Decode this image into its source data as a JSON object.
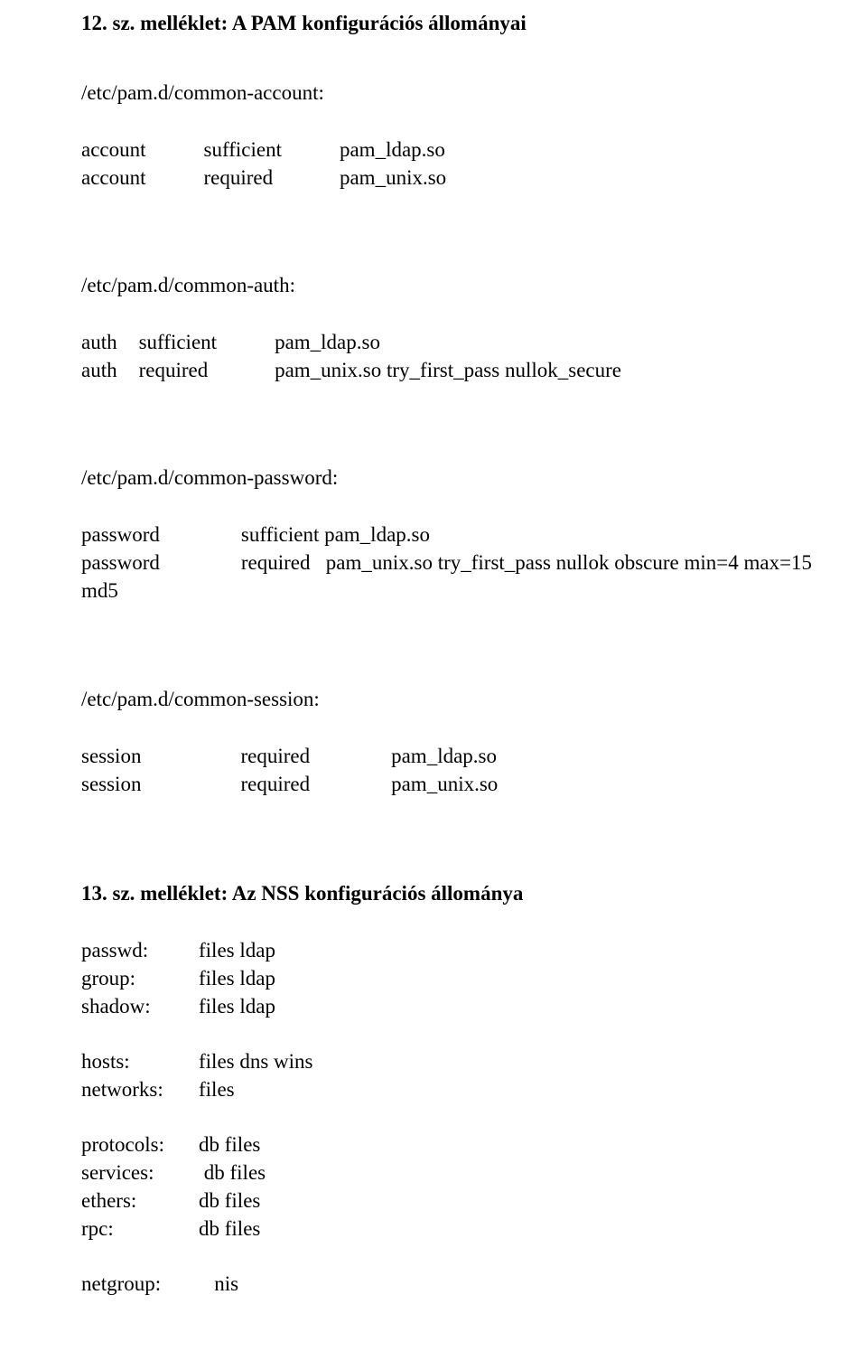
{
  "section12": {
    "title": "12. sz. melléklet: A PAM konfigurációs állományai",
    "account": {
      "path": "/etc/pam.d/common-account:",
      "rows": [
        {
          "facility": "account",
          "control": "sufficient",
          "module": "pam_ldap.so"
        },
        {
          "facility": "account",
          "control": "required",
          "module": "pam_unix.so"
        }
      ]
    },
    "auth": {
      "path": "/etc/pam.d/common-auth:",
      "rows": [
        {
          "facility": "auth",
          "control": "sufficient",
          "module": "pam_ldap.so"
        },
        {
          "facility": "auth",
          "control": "required",
          "module": "pam_unix.so try_first_pass nullok_secure"
        }
      ]
    },
    "password": {
      "path": "/etc/pam.d/common-password:",
      "rows": [
        {
          "facility": "password",
          "rest": "sufficient pam_ldap.so"
        },
        {
          "facility": "password",
          "rest": "required   pam_unix.so try_first_pass nullok obscure min=4 max=15"
        },
        {
          "facility": "md5",
          "rest": ""
        }
      ]
    },
    "session": {
      "path": "/etc/pam.d/common-session:",
      "rows": [
        {
          "facility": "session",
          "control": "required",
          "module": "pam_ldap.so"
        },
        {
          "facility": "session",
          "control": "required",
          "module": "pam_unix.so"
        }
      ]
    }
  },
  "section13": {
    "title": "13. sz. melléklet: Az NSS konfigurációs állománya",
    "group1": [
      {
        "key": "passwd:",
        "value": "files ldap"
      },
      {
        "key": "group:",
        "value": "files ldap"
      },
      {
        "key": "shadow:",
        "value": "files ldap"
      }
    ],
    "group2": [
      {
        "key": "hosts:",
        "value": "files dns wins"
      },
      {
        "key": "networks:",
        "value": "files"
      }
    ],
    "group3": [
      {
        "key": "protocols:",
        "value": "db files"
      },
      {
        "key": "services:",
        "value": " db files"
      },
      {
        "key": "ethers:",
        "value": "db files"
      },
      {
        "key": "rpc:",
        "value": "db files"
      }
    ],
    "group4": [
      {
        "key": "netgroup:",
        "value": "   nis"
      }
    ]
  }
}
